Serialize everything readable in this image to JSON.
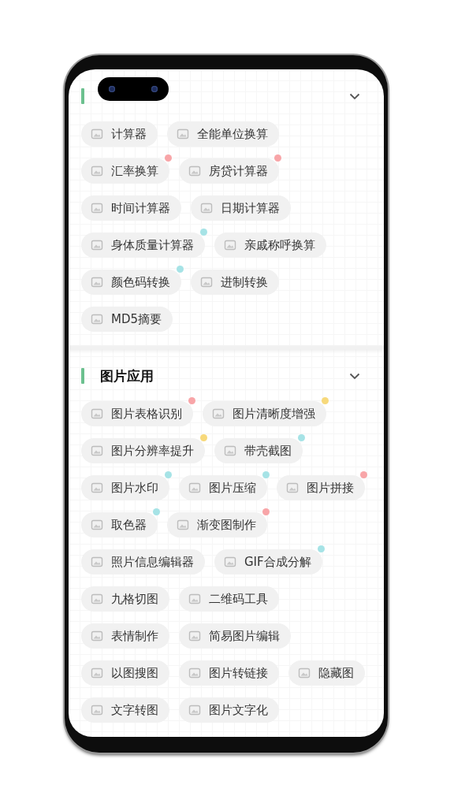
{
  "sections": [
    {
      "expanded": true,
      "rows": [
        [
          {
            "label": "计算器"
          },
          {
            "label": "全能单位换算"
          }
        ],
        [
          {
            "label": "汇率换算",
            "color": "#f8a5a8"
          },
          {
            "label": "房贷计算器",
            "color": "#f8a5a8"
          }
        ],
        [
          {
            "label": "时间计算器"
          },
          {
            "label": "日期计算器"
          }
        ],
        [
          {
            "label": "身体质量计算器",
            "color": "#a6e3e6"
          },
          {
            "label": "亲戚称呼换算"
          }
        ],
        [
          {
            "label": "颜色码转换",
            "color": "#a6e3e6"
          },
          {
            "label": "进制转换"
          }
        ],
        [
          {
            "label": "MD5摘要"
          }
        ]
      ]
    },
    {
      "title": "图片应用",
      "expanded": true,
      "rows": [
        [
          {
            "label": "图片表格识别",
            "color": "#f8a5a8"
          },
          {
            "label": "图片清晰度增强",
            "color": "#f7d97b"
          }
        ],
        [
          {
            "label": "图片分辨率提升",
            "color": "#f7d97b"
          },
          {
            "label": "带壳截图",
            "color": "#a6e3e6"
          }
        ],
        [
          {
            "label": "图片水印",
            "color": "#a6e3e6"
          },
          {
            "label": "图片压缩",
            "color": "#a6e3e6"
          },
          {
            "label": "图片拼接",
            "color": "#f8a5a8"
          }
        ],
        [
          {
            "label": "取色器",
            "color": "#a6e3e6"
          },
          {
            "label": "渐变图制作",
            "color": "#f8a5a8"
          }
        ],
        [
          {
            "label": "照片信息编辑器"
          },
          {
            "label": "GIF合成分解",
            "color": "#a6e3e6"
          }
        ],
        [
          {
            "label": "九格切图"
          },
          {
            "label": "二维码工具"
          }
        ],
        [
          {
            "label": "表情制作"
          },
          {
            "label": "简易图片编辑"
          }
        ],
        [
          {
            "label": "以图搜图"
          },
          {
            "label": "图片转链接"
          },
          {
            "label": "隐藏图"
          }
        ],
        [
          {
            "label": "文字转图"
          },
          {
            "label": "图片文字化"
          }
        ]
      ]
    }
  ]
}
